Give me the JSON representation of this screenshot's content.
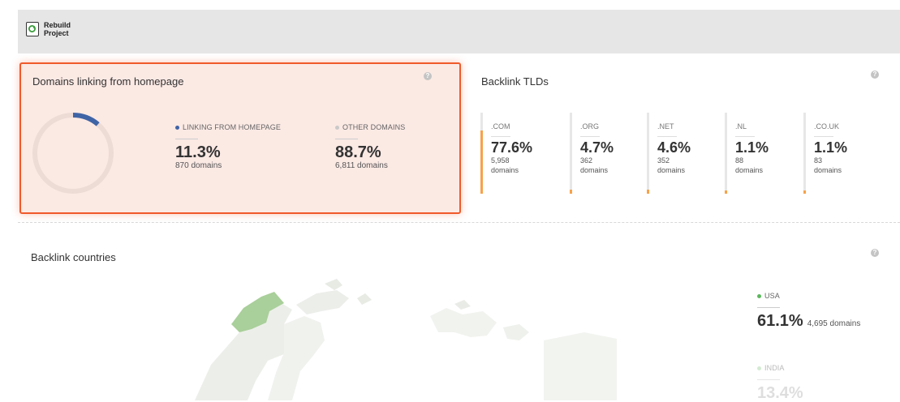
{
  "toolbar": {
    "rebuild_label": "Rebuild Project"
  },
  "homepage_card": {
    "title": "Domains linking from homepage",
    "progress": 0.113,
    "linking": {
      "legend": "LINKING FROM HOMEPAGE",
      "pct": "11.3%",
      "count": "870 domains",
      "color": "#3f64a6"
    },
    "other": {
      "legend": "OTHER DOMAINS",
      "pct": "88.7%",
      "count": "6,811 domains",
      "color": "#c9c9c9"
    }
  },
  "tld_card": {
    "title": "Backlink TLDs",
    "items": [
      {
        "name": ".COM",
        "pct": "77.6%",
        "count": "5,958",
        "unit": "domains",
        "share": 0.776
      },
      {
        "name": ".ORG",
        "pct": "4.7%",
        "count": "362",
        "unit": "domains",
        "share": 0.047
      },
      {
        "name": ".NET",
        "pct": "4.6%",
        "count": "352",
        "unit": "domains",
        "share": 0.046
      },
      {
        "name": ".NL",
        "pct": "1.1%",
        "count": "88",
        "unit": "domains",
        "share": 0.011
      },
      {
        "name": ".CO.UK",
        "pct": "1.1%",
        "count": "83",
        "unit": "domains",
        "share": 0.011
      }
    ],
    "accent": "#f7a24a"
  },
  "countries_card": {
    "title": "Backlink countries",
    "countries": [
      {
        "name": "USA",
        "pct": "61.1%",
        "count": "4,695 domains",
        "color": "#5cb85c"
      },
      {
        "name": "INDIA",
        "pct": "13.4%",
        "color": "#9ed39e"
      }
    ]
  }
}
